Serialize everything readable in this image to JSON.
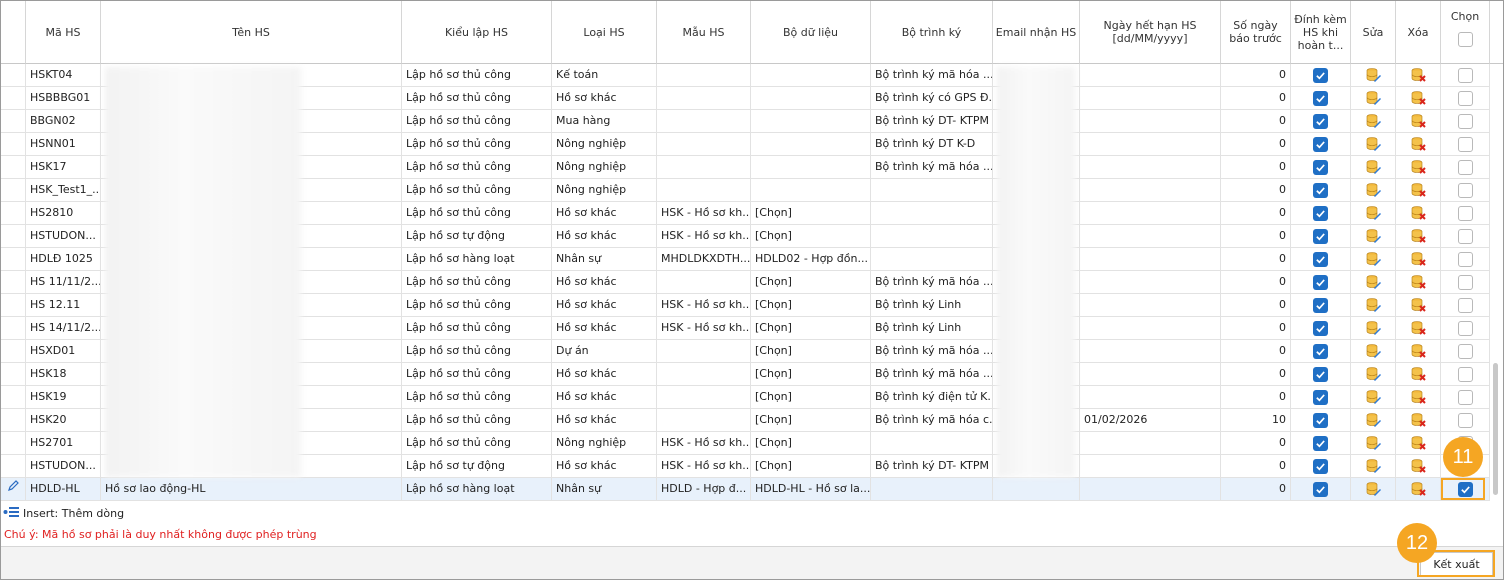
{
  "columns": {
    "ma_hs": "Mã HS",
    "ten_hs": "Tên HS",
    "kieu_lap": "Kiểu lập HS",
    "loai_hs": "Loại HS",
    "mau_hs": "Mẫu HS",
    "bo_du_lieu": "Bộ dữ liệu",
    "bo_trinh_ky": "Bộ trình ký",
    "email": "Email nhận HS",
    "ngay_het_han_1": "Ngày hết hạn HS",
    "ngay_het_han_2": "[dd/MM/yyyy]",
    "so_ngay_1": "Số ngày",
    "so_ngay_2": "báo trước",
    "dinh_kem_1": "Đính kèm",
    "dinh_kem_2": "HS khi",
    "dinh_kem_3": "hoàn t...",
    "sua": "Sửa",
    "xoa": "Xóa",
    "chon": "Chọn"
  },
  "rows": [
    {
      "ma": "HSKT04",
      "ten": "",
      "kieu": "Lập hồ sơ thủ công",
      "loai": "Kế toán",
      "mau": "",
      "bo_dl": "",
      "trinh_ky": "Bộ trình ký mã hóa ...",
      "ngay": "",
      "so_ngay": "0",
      "dinh_kem": true,
      "chon": false
    },
    {
      "ma": "HSBBBG01",
      "ten": "",
      "kieu": "Lập hồ sơ thủ công",
      "loai": "Hồ sơ khác",
      "mau": "",
      "bo_dl": "",
      "trinh_ky": "Bộ trình ký có GPS Đ...",
      "ngay": "",
      "so_ngay": "0",
      "dinh_kem": true,
      "chon": false
    },
    {
      "ma": "BBGN02",
      "ten": "",
      "kieu": "Lập hồ sơ thủ công",
      "loai": "Mua hàng",
      "mau": "",
      "bo_dl": "",
      "trinh_ky": "Bộ trình ký DT- KTPM",
      "ngay": "",
      "so_ngay": "0",
      "dinh_kem": true,
      "chon": false
    },
    {
      "ma": "HSNN01",
      "ten": "",
      "kieu": "Lập hồ sơ thủ công",
      "loai": "Nông nghiệp",
      "mau": "",
      "bo_dl": "",
      "trinh_ky": "Bộ trình ký DT K-D",
      "ngay": "",
      "so_ngay": "0",
      "dinh_kem": true,
      "chon": false
    },
    {
      "ma": "HSK17",
      "ten": "",
      "kieu": "Lập hồ sơ thủ công",
      "loai": "Nông nghiệp",
      "mau": "",
      "bo_dl": "",
      "trinh_ky": "Bộ trình ký mã hóa ...",
      "ngay": "",
      "so_ngay": "0",
      "dinh_kem": true,
      "chon": false
    },
    {
      "ma": "HSK_Test1_...",
      "ten": "",
      "kieu": "Lập hồ sơ thủ công",
      "loai": "Nông nghiệp",
      "mau": "",
      "bo_dl": "",
      "trinh_ky": "",
      "ngay": "",
      "so_ngay": "0",
      "dinh_kem": true,
      "chon": false
    },
    {
      "ma": "HS2810",
      "ten": "",
      "kieu": "Lập hồ sơ thủ công",
      "loai": "Hồ sơ khác",
      "mau": "HSK - Hồ sơ kh...",
      "bo_dl": "[Chọn]",
      "trinh_ky": "",
      "ngay": "",
      "so_ngay": "0",
      "dinh_kem": true,
      "chon": false
    },
    {
      "ma": "HSTUDON...",
      "ten": "",
      "kieu": "Lập hồ sơ tự động",
      "loai": "Hồ sơ khác",
      "mau": "HSK - Hồ sơ kh...",
      "bo_dl": "[Chọn]",
      "trinh_ky": "",
      "ngay": "",
      "so_ngay": "0",
      "dinh_kem": true,
      "chon": false
    },
    {
      "ma": "HDLĐ 1025",
      "ten": "",
      "kieu": "Lập hồ sơ hàng loạt",
      "loai": "Nhân sự",
      "mau": "MHDLDKXDTH...",
      "bo_dl": "HDLD02 - Hợp đồn...",
      "trinh_ky": "",
      "ngay": "",
      "so_ngay": "0",
      "dinh_kem": true,
      "chon": false
    },
    {
      "ma": "HS 11/11/2...",
      "ten": "",
      "kieu": "Lập hồ sơ thủ công",
      "loai": "Hồ sơ khác",
      "mau": "",
      "bo_dl": "[Chọn]",
      "trinh_ky": "Bộ trình ký mã hóa ...",
      "ngay": "",
      "so_ngay": "0",
      "dinh_kem": true,
      "chon": false
    },
    {
      "ma": "HS 12.11",
      "ten": "",
      "kieu": "Lập hồ sơ thủ công",
      "loai": "Hồ sơ khác",
      "mau": "HSK - Hồ sơ kh...",
      "bo_dl": "[Chọn]",
      "trinh_ky": "Bộ trình ký Linh",
      "ngay": "",
      "so_ngay": "0",
      "dinh_kem": true,
      "chon": false
    },
    {
      "ma": "HS 14/11/2...",
      "ten": "",
      "kieu": "Lập hồ sơ thủ công",
      "loai": "Hồ sơ khác",
      "mau": "HSK - Hồ sơ kh...",
      "bo_dl": "[Chọn]",
      "trinh_ky": "Bộ trình ký Linh",
      "ngay": "",
      "so_ngay": "0",
      "dinh_kem": true,
      "chon": false
    },
    {
      "ma": "HSXD01",
      "ten": "",
      "kieu": "Lập hồ sơ thủ công",
      "loai": "Dự án",
      "mau": "",
      "bo_dl": "[Chọn]",
      "trinh_ky": "Bộ trình ký mã hóa ...",
      "ngay": "",
      "so_ngay": "0",
      "dinh_kem": true,
      "chon": false
    },
    {
      "ma": "HSK18",
      "ten": "",
      "kieu": "Lập hồ sơ thủ công",
      "loai": "Hồ sơ khác",
      "mau": "",
      "bo_dl": "[Chọn]",
      "trinh_ky": "Bộ trình ký mã hóa ...",
      "ngay": "",
      "so_ngay": "0",
      "dinh_kem": true,
      "chon": false
    },
    {
      "ma": "HSK19",
      "ten": "",
      "kieu": "Lập hồ sơ thủ công",
      "loai": "Hồ sơ khác",
      "mau": "",
      "bo_dl": "[Chọn]",
      "trinh_ky": "Bộ trình ký điện tử K...",
      "ngay": "",
      "so_ngay": "0",
      "dinh_kem": true,
      "chon": false
    },
    {
      "ma": "HSK20",
      "ten": "",
      "kieu": "Lập hồ sơ thủ công",
      "loai": "Hồ sơ khác",
      "mau": "",
      "bo_dl": "[Chọn]",
      "trinh_ky": "Bộ trình ký mã hóa c...",
      "ngay": "01/02/2026",
      "so_ngay": "10",
      "dinh_kem": true,
      "chon": false
    },
    {
      "ma": "HS2701",
      "ten": "",
      "kieu": "Lập hồ sơ thủ công",
      "loai": "Nông nghiệp",
      "mau": "HSK - Hồ sơ kh...",
      "bo_dl": "[Chọn]",
      "trinh_ky": "",
      "ngay": "",
      "so_ngay": "0",
      "dinh_kem": true,
      "chon": false
    },
    {
      "ma": "HSTUDON...",
      "ten": "",
      "kieu": "Lập hồ sơ tự động",
      "loai": "Hồ sơ khác",
      "mau": "HSK - Hồ sơ kh...",
      "bo_dl": "[Chọn]",
      "trinh_ky": "Bộ trình ký DT- KTPM",
      "ngay": "",
      "so_ngay": "0",
      "dinh_kem": true,
      "chon": false
    },
    {
      "ma": "HDLD-HL",
      "ten": "Hồ sơ lao động-HL",
      "kieu": "Lập hồ sơ hàng loạt",
      "loai": "Nhân sự",
      "mau": "HDLD - Hợp đ...",
      "bo_dl": "HDLD-HL - Hồ sơ la...",
      "trinh_ky": "",
      "ngay": "",
      "so_ngay": "0",
      "dinh_kem": true,
      "chon": true,
      "selected": true
    }
  ],
  "footer": {
    "insert_label": "Insert: Thêm dòng",
    "note": "Chú ý: Mã hồ sơ phải là duy nhất không được phép trùng",
    "export_label": "Kết xuất"
  },
  "callouts": {
    "b11": "11",
    "b12": "12"
  },
  "colors": {
    "accent_orange": "#f5a623",
    "checkbox_blue": "#1f6fc5",
    "note_red": "#e02020",
    "selected_row": "#e8f1fb"
  }
}
